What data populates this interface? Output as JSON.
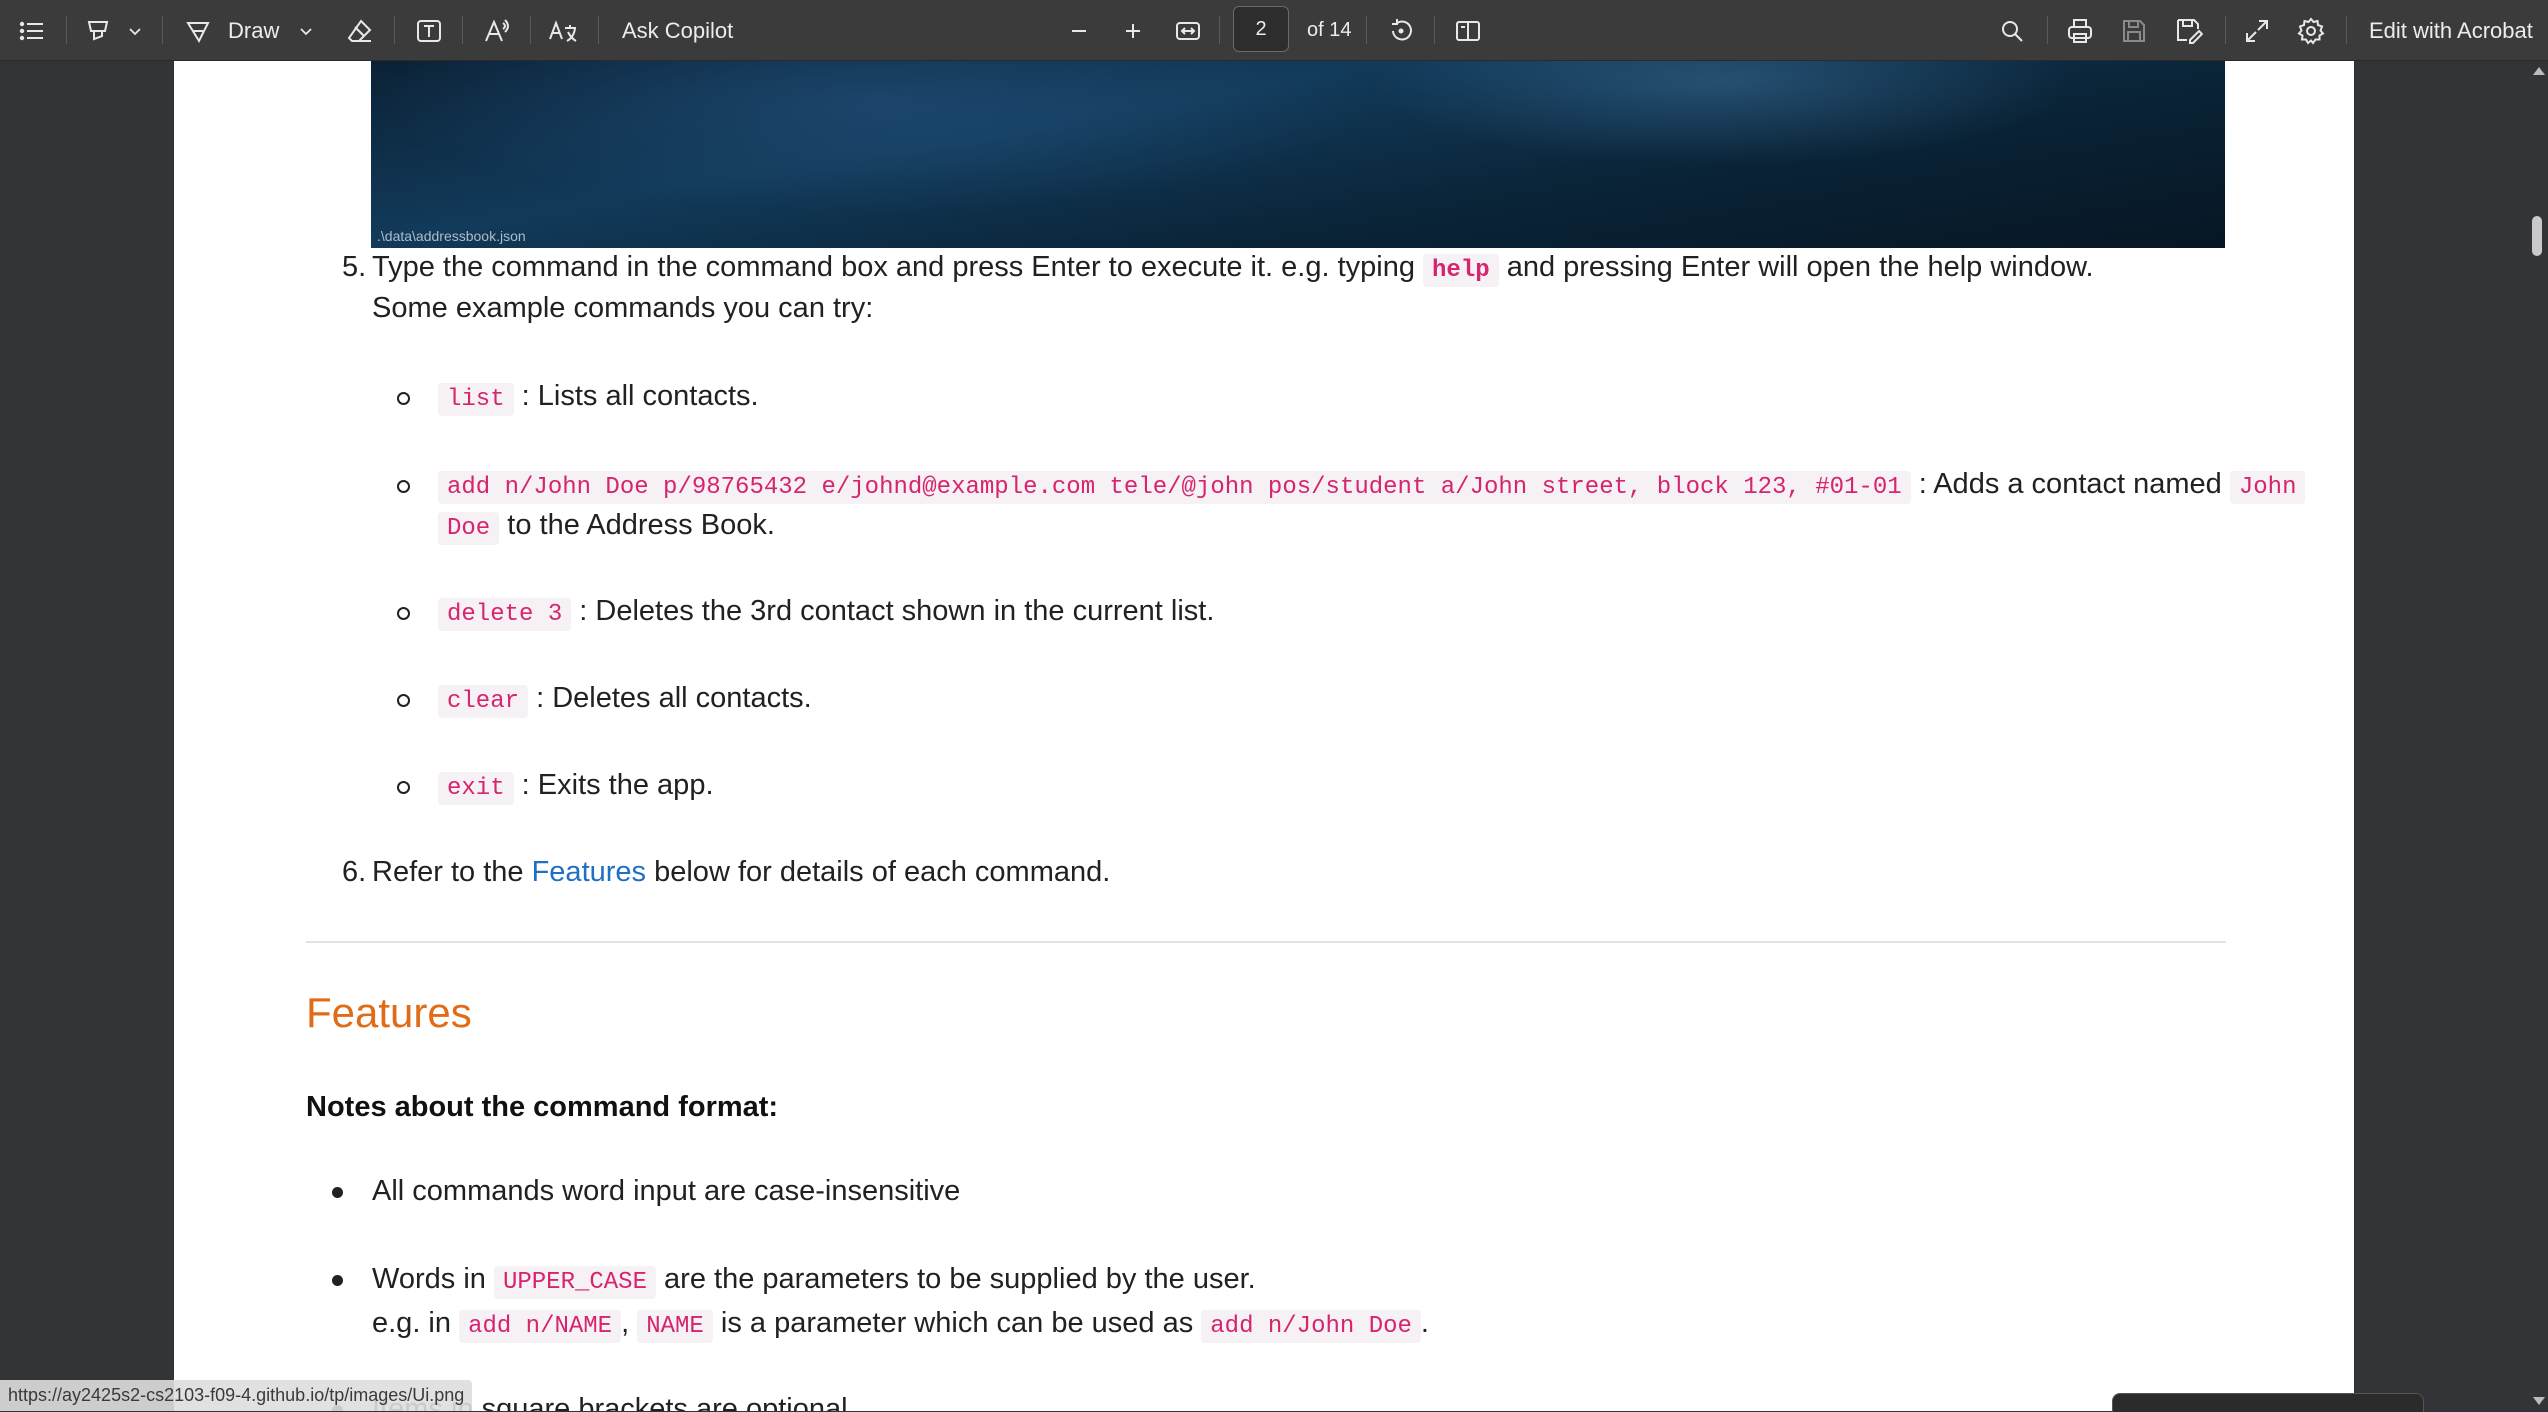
{
  "toolbar": {
    "draw_label": "Draw",
    "ask_copilot_label": "Ask Copilot",
    "page_current": "2",
    "page_total": "of 14",
    "edit_acrobat_label": "Edit with Acrobat"
  },
  "screenshot": {
    "caption": ".\\data\\addressbook.json"
  },
  "steps": {
    "step5_number": "5.",
    "step5_text_before": "Type the command in the command box and press Enter to execute it. e.g. typing",
    "step5_code": "help",
    "step5_text_after": "and pressing Enter will open the help window.",
    "step5_line2": "Some example commands you can try:",
    "examples": [
      {
        "code": "list",
        "desc": ": Lists all contacts."
      },
      {
        "code": "add n/John Doe p/98765432 e/johnd@example.com tele/@john pos/student a/John street, block 123, #01-01",
        "desc": ": Adds a contact named",
        "code2a": "John",
        "code2b": "Doe",
        "desc2": "to the Address Book."
      },
      {
        "code": "delete 3",
        "desc": ": Deletes the 3rd contact shown in the current list."
      },
      {
        "code": "clear",
        "desc": ": Deletes all contacts."
      },
      {
        "code": "exit",
        "desc": ": Exits the app."
      }
    ],
    "step6_number": "6.",
    "step6_before": "Refer to the",
    "step6_link": "Features",
    "step6_after": "below for details of each command."
  },
  "features": {
    "heading": "Features",
    "notes_heading": "Notes about the command format:",
    "bullet1": "All commands word input are case-insensitive",
    "bullet2_before": "Words in",
    "bullet2_code": "UPPER_CASE",
    "bullet2_after": "are the parameters to be supplied by the user.",
    "bullet2_l2_a": "e.g. in",
    "bullet2_l2_code1": "add n/NAME",
    "bullet2_l2_comma": ",",
    "bullet2_l2_code2": "NAME",
    "bullet2_l2_b": "is a parameter which can be used as",
    "bullet2_l2_code3": "add n/John Doe",
    "bullet2_l2_end": ".",
    "bullet3_partial": "Items in square brackets are optional."
  },
  "status_url": "https://ay2425s2-cs2103-f09-4.github.io/tp/images/Ui.png"
}
